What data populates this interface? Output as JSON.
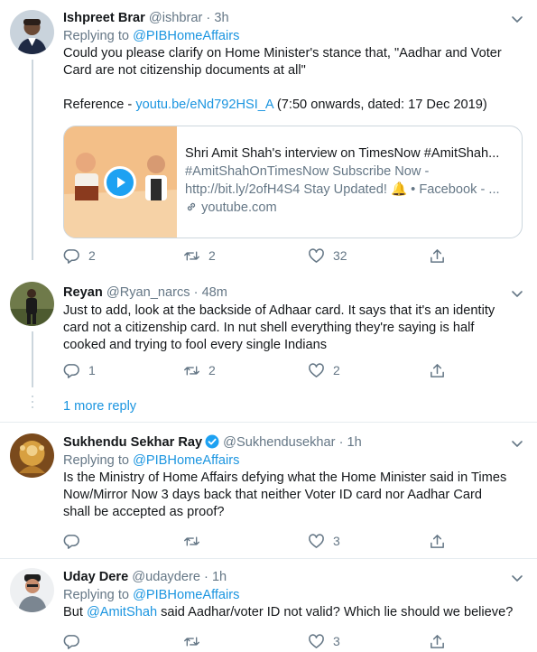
{
  "tweets": [
    {
      "name": "Ishpreet Brar",
      "handle": "@ishbrar",
      "separator": "·",
      "time": "3h",
      "replying_label": "Replying to",
      "replying_to": "@PIBHomeAffairs",
      "text_lines": [
        "Could you please clarify on Home Minister's stance that, \"Aadhar and Voter",
        "Card are not citizenship documents at all\""
      ],
      "reference_label": "Reference - ",
      "reference_link": "youtu.be/eNd792HSI_A",
      "reference_note": " (7:50 onwards, dated: 17 Dec 2019)",
      "card": {
        "title": "Shri Amit Shah's interview on TimesNow #AmitShah...",
        "desc_line1": "#AmitShahOnTimesNow Subscribe Now -",
        "desc_line2": "http://bit.ly/2ofH4S4 Stay Updated! 🔔 • Facebook - ...",
        "domain": "youtube.com"
      },
      "replies": "2",
      "retweets": "2",
      "likes": "32"
    },
    {
      "name": "Reyan",
      "handle": "@Ryan_narcs",
      "separator": "·",
      "time": "48m",
      "text_lines": [
        "Just to add, look at the backside of Adhaar card. It says that it's an identity",
        "card not a citizenship card. In nut shell everything they're saying is half",
        "cooked and trying to fool every single Indians"
      ],
      "replies": "1",
      "retweets": "2",
      "likes": "2"
    },
    {
      "name": "Sukhendu Sekhar Ray",
      "handle": "@Sukhendusekhar",
      "separator": "·",
      "time": "1h",
      "replying_label": "Replying to",
      "replying_to": "@PIBHomeAffairs",
      "text_lines": [
        "Is the Ministry of Home Affairs defying what the Home Minister said in Times",
        "Now/Mirror Now 3 days back that neither Voter ID card nor Aadhar Card",
        "shall be accepted as proof?"
      ],
      "replies": "",
      "retweets": "",
      "likes": "3"
    },
    {
      "name": "Uday Dere",
      "handle": "@udaydere",
      "separator": "·",
      "time": "1h",
      "replying_label": "Replying to",
      "replying_to": "@PIBHomeAffairs",
      "text_prefix": "But ",
      "text_mention": "@AmitShah",
      "text_suffix": " said Aadhar/voter ID not valid? Which lie should we believe?",
      "replies": "",
      "retweets": "",
      "likes": "3"
    }
  ],
  "more_replies": "1 more reply",
  "colors": {
    "link": "#1b95e0",
    "muted": "#657786",
    "text": "#14171a",
    "border": "#ccd6dd",
    "verified": "#1da1f2"
  },
  "icons": [
    "reply-icon",
    "retweet-icon",
    "like-icon",
    "share-icon",
    "chevron-down-icon",
    "verified-badge-icon",
    "link-icon",
    "play-icon",
    "bell-icon"
  ]
}
